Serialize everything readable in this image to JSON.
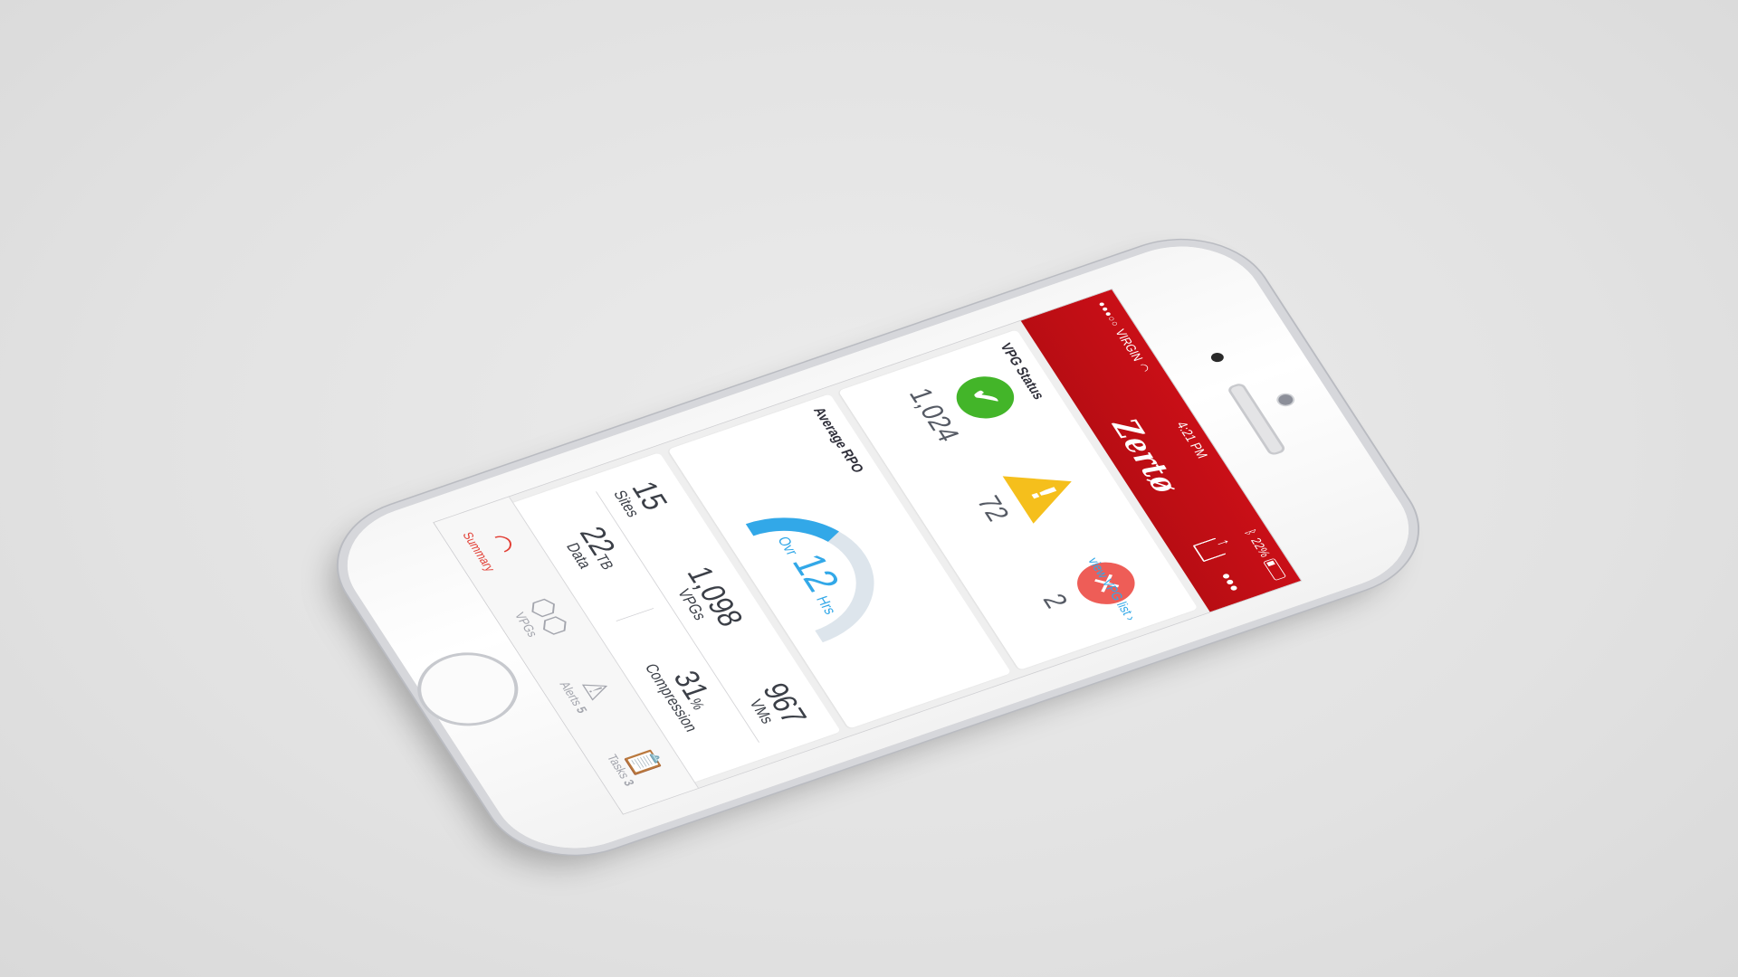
{
  "status_bar": {
    "carrier": "VIRGIN",
    "time": "4:21 PM",
    "battery": "22%"
  },
  "nav": {
    "brand": "Zertø"
  },
  "vpg_status": {
    "title": "VPG Status",
    "ok_count": "1,024",
    "warning_count": "72",
    "error_count": "2",
    "link": "view VPG list ›"
  },
  "rpo": {
    "title": "Average RPO",
    "prefix": "Ovr",
    "value": "12",
    "unit": "Hrs",
    "gauge_fill": 0.35
  },
  "stats": {
    "sites_value": "15",
    "sites_label": "Sites",
    "vpgs_value": "1,098",
    "vpgs_label": "VPGs",
    "vms_value": "967",
    "vms_label": "VMs",
    "data_value": "22",
    "data_unit": "TB",
    "data_label": "Data",
    "compression_value": "31",
    "compression_unit": "%",
    "compression_label": "Compression"
  },
  "tabs": [
    {
      "label": "Summary",
      "count": ""
    },
    {
      "label": "VPGs",
      "count": ""
    },
    {
      "label": "Alerts",
      "count": "5"
    },
    {
      "label": "Tasks",
      "count": "3"
    }
  ],
  "colors": {
    "brand_red": "#c90f17",
    "ok_green": "#43b529",
    "warn_yellow": "#f5bf1c",
    "error_red": "#ee5d57",
    "accent_blue": "#32a8e8"
  }
}
